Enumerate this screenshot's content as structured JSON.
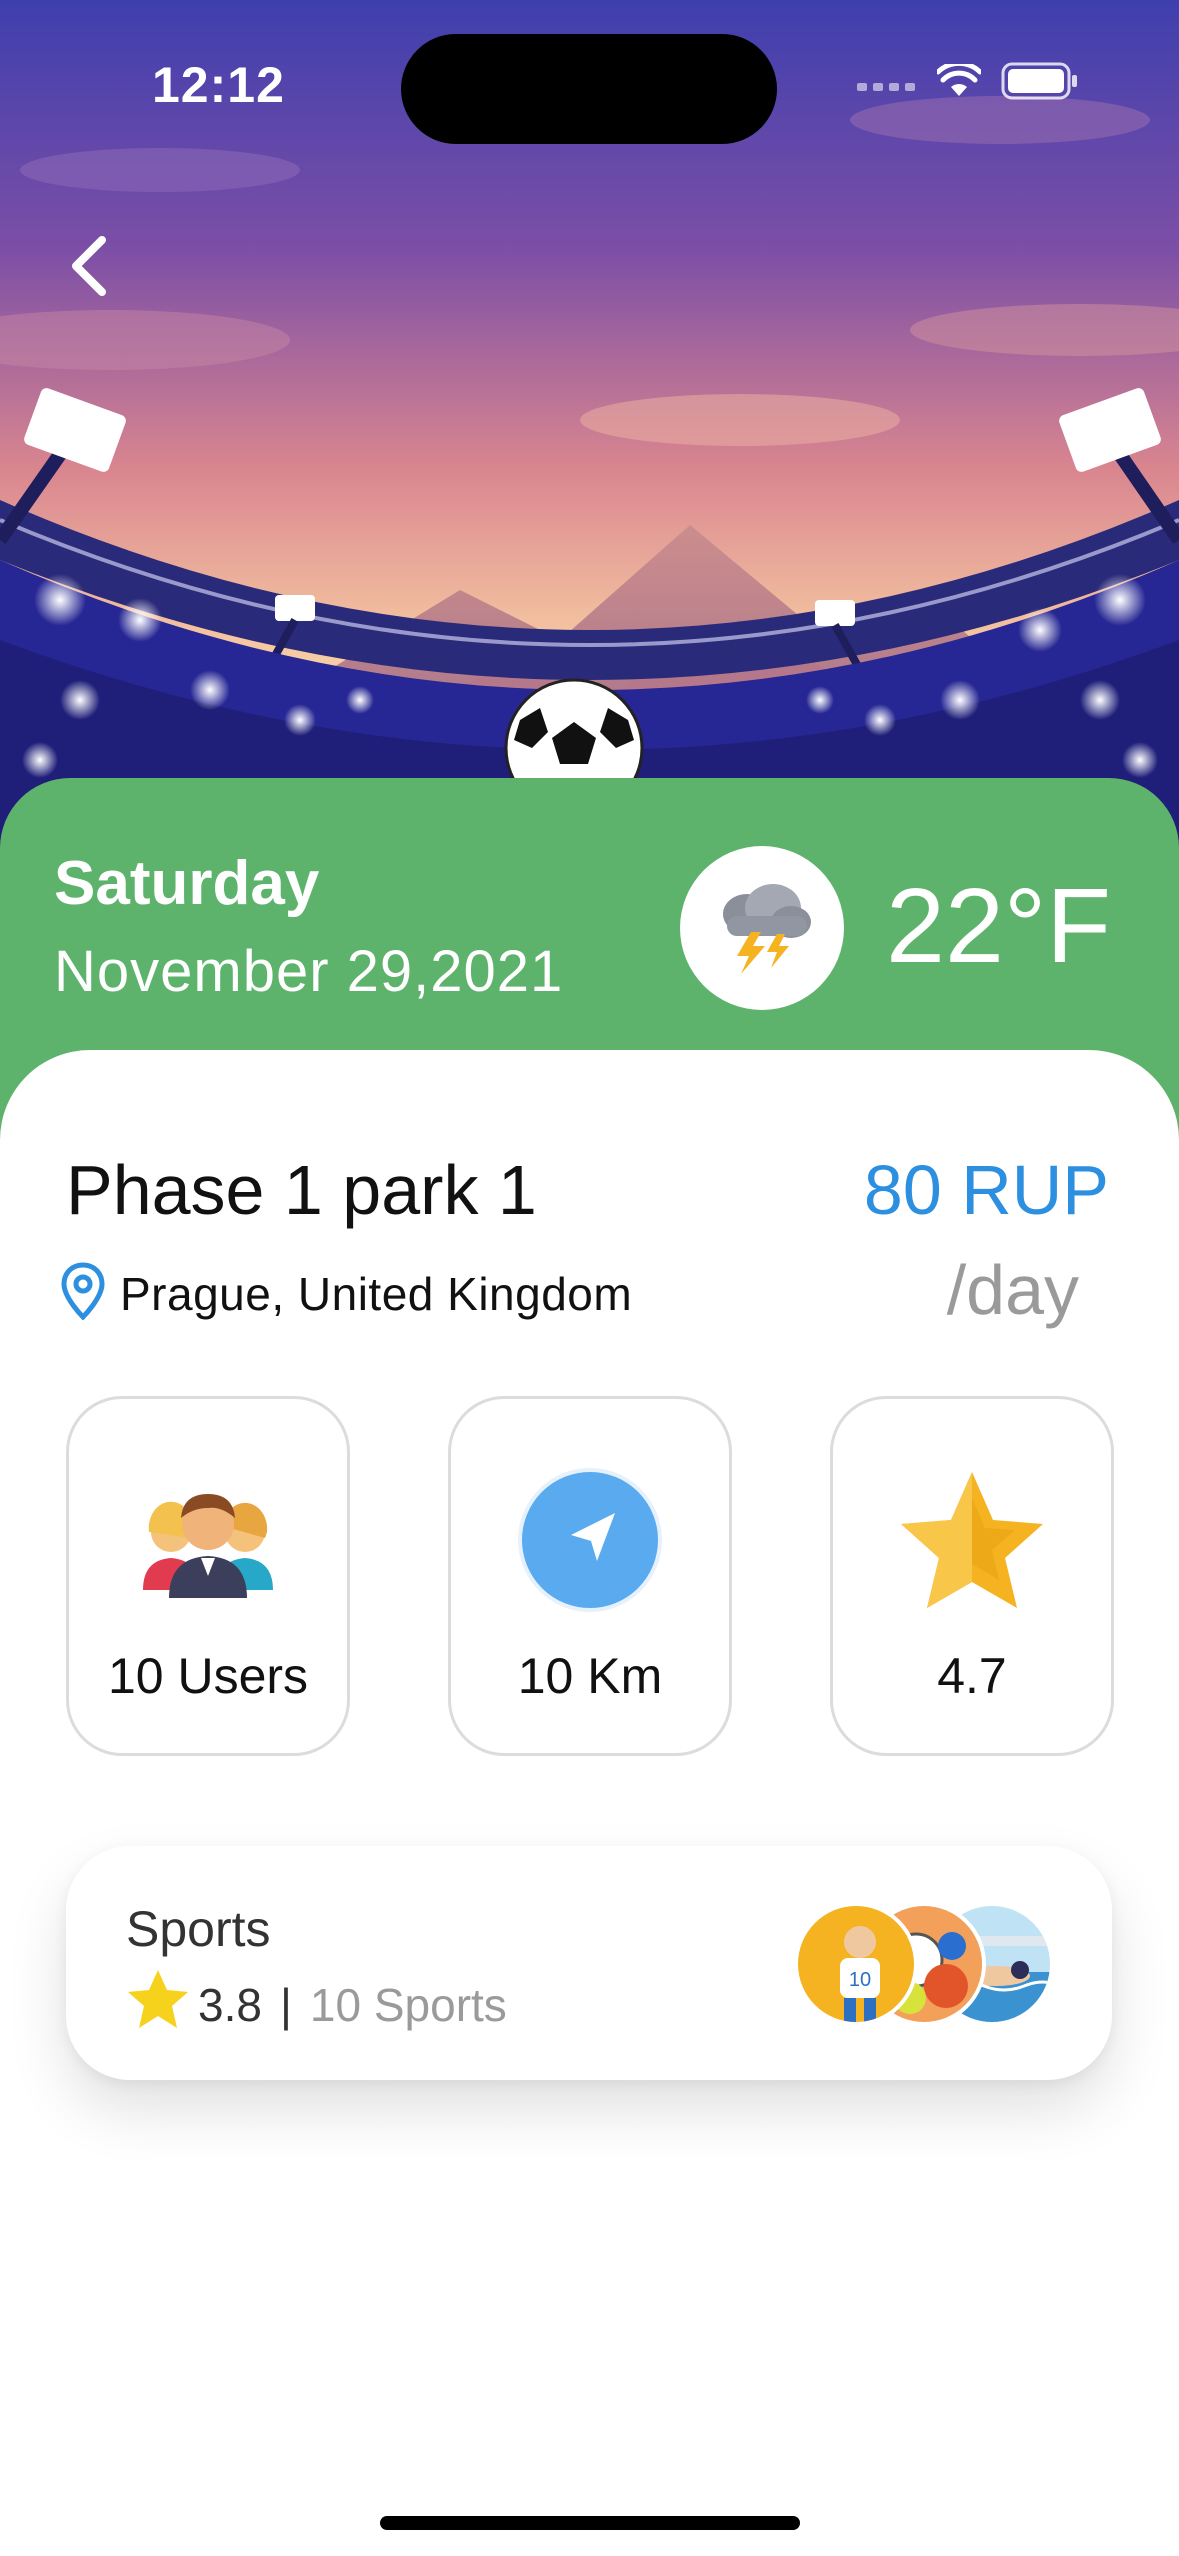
{
  "status_bar": {
    "time": "12:12"
  },
  "header": {
    "day": "Saturday",
    "date": "November 29,2021",
    "weather_icon": "thunderstorm-icon",
    "temperature": "22°F"
  },
  "park": {
    "name": "Phase 1 park 1",
    "location": "Prague, United Kingdom",
    "price": "80 RUP",
    "price_unit": "/day"
  },
  "stats": [
    {
      "icon": "users-icon",
      "label": "10 Users"
    },
    {
      "icon": "navigation-icon",
      "label": "10 Km"
    },
    {
      "icon": "star-icon",
      "label": "4.7"
    }
  ],
  "sports": {
    "title": "Sports",
    "rating": "3.8",
    "separator": "|",
    "count": "10 Sports",
    "avatars": [
      "football-player-avatar",
      "tennis-balls-avatar",
      "swimming-avatar"
    ]
  },
  "colors": {
    "green_panel": "#5db36b",
    "price_blue": "#2d8fe0",
    "text_dark": "#111111",
    "text_muted": "#9a9a9a"
  }
}
